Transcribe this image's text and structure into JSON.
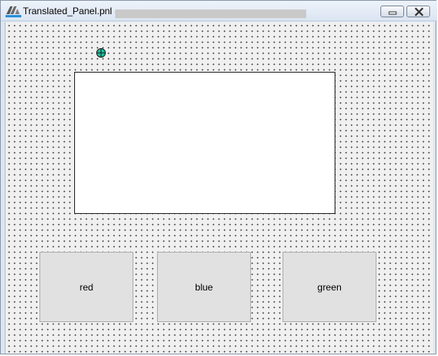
{
  "window": {
    "title": "Translated_Panel.pnl -",
    "icon": "app-logo-icon",
    "controls": {
      "minimize_icon": "minimize-icon",
      "close_icon": "close-icon"
    }
  },
  "panel": {
    "origin_marker_icon": "origin-crosshair-icon",
    "buttons": [
      {
        "label": "red"
      },
      {
        "label": "blue"
      },
      {
        "label": "green"
      }
    ]
  },
  "colors": {
    "panel_background": "#f0f0f0",
    "button_face": "#e1e1e1",
    "marker_fill": "#20c0a0"
  }
}
